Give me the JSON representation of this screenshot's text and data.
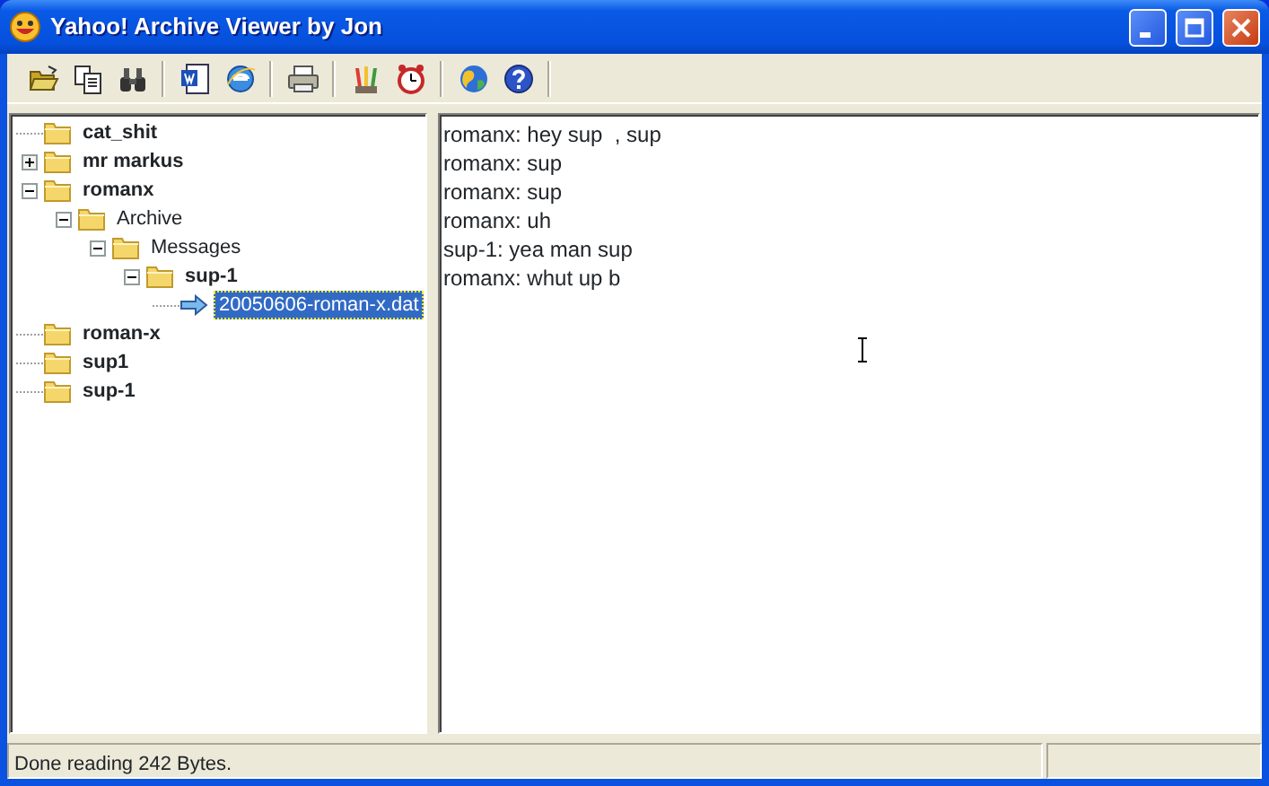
{
  "window": {
    "title": "Yahoo! Archive Viewer by Jon"
  },
  "toolbar": [
    {
      "kind": "open"
    },
    {
      "kind": "copy"
    },
    {
      "kind": "find"
    },
    {
      "kind": "sep"
    },
    {
      "kind": "word"
    },
    {
      "kind": "browser"
    },
    {
      "kind": "sep"
    },
    {
      "kind": "print"
    },
    {
      "kind": "sep"
    },
    {
      "kind": "pencils"
    },
    {
      "kind": "clock"
    },
    {
      "kind": "sep"
    },
    {
      "kind": "globe"
    },
    {
      "kind": "help"
    },
    {
      "kind": "sep"
    }
  ],
  "tree": [
    {
      "label": "cat_shit",
      "kind": "folder",
      "bold": true,
      "selected": false
    },
    {
      "label": "mr markus",
      "kind": "folder",
      "bold": true,
      "expanded": false,
      "selected": false
    },
    {
      "label": "romanx",
      "kind": "folder",
      "bold": true,
      "expanded": true,
      "selected": false,
      "children": [
        {
          "label": "Archive",
          "kind": "folder",
          "bold": false,
          "expanded": true,
          "selected": false,
          "children": [
            {
              "label": "Messages",
              "kind": "folder",
              "bold": false,
              "expanded": true,
              "selected": false,
              "children": [
                {
                  "label": "sup-1",
                  "kind": "folder",
                  "bold": true,
                  "expanded": true,
                  "selected": false,
                  "children": [
                    {
                      "label": "20050606-roman-x.dat",
                      "kind": "file",
                      "bold": false,
                      "selected": true
                    }
                  ]
                }
              ]
            }
          ]
        }
      ]
    },
    {
      "label": "roman-x",
      "kind": "folder",
      "bold": true,
      "selected": false
    },
    {
      "label": "sup1",
      "kind": "folder",
      "bold": true,
      "selected": false
    },
    {
      "label": "sup-1",
      "kind": "folder",
      "bold": true,
      "selected": false
    }
  ],
  "messages": [
    "romanx: hey sup  , sup",
    "romanx: sup",
    "romanx: sup",
    "romanx: uh",
    "sup-1: yea man sup",
    "romanx: whut up b"
  ],
  "status_bar": {
    "text": "Done reading 242 Bytes."
  }
}
